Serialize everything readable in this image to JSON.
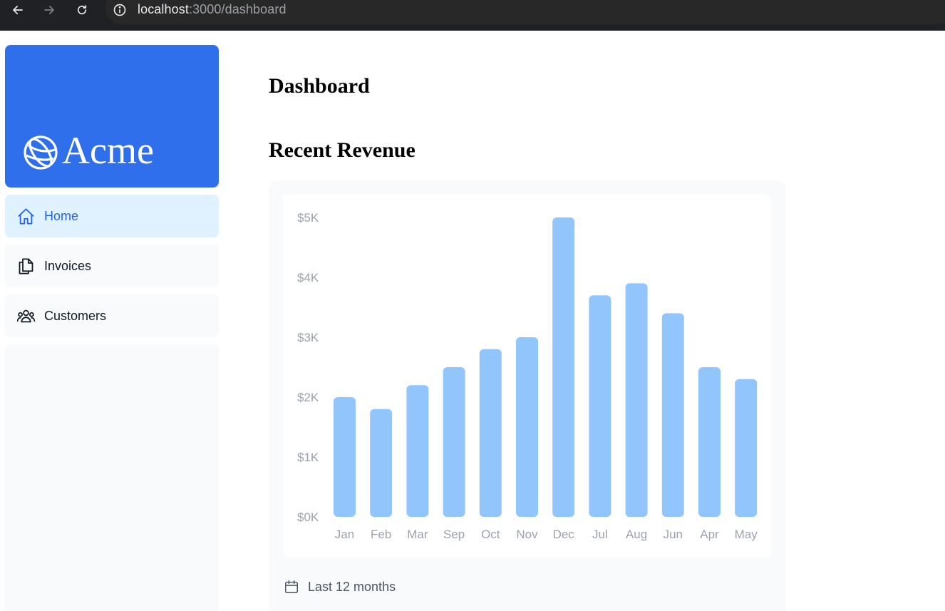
{
  "browser": {
    "url_host": "localhost",
    "url_path": ":3000/dashboard",
    "back_icon": "arrow-left-icon",
    "forward_icon": "arrow-right-icon",
    "reload_icon": "reload-icon",
    "info_icon": "info-icon"
  },
  "sidebar": {
    "logo_text": "Acme",
    "logo_icon": "globe-icon",
    "brand_color": "#2f6feb",
    "items": [
      {
        "label": "Home",
        "icon": "home-icon",
        "active": true
      },
      {
        "label": "Invoices",
        "icon": "document-duplicate-icon",
        "active": false
      },
      {
        "label": "Customers",
        "icon": "user-group-icon",
        "active": false
      }
    ]
  },
  "main": {
    "title": "Dashboard",
    "section_title": "Recent Revenue",
    "footer_label": "Last 12 months",
    "footer_icon": "calendar-icon"
  },
  "chart_data": {
    "type": "bar",
    "title": "",
    "xlabel": "",
    "ylabel": "",
    "categories": [
      "Jan",
      "Feb",
      "Mar",
      "Sep",
      "Oct",
      "Nov",
      "Dec",
      "Jul",
      "Aug",
      "Jun",
      "Apr",
      "May"
    ],
    "values": [
      2000,
      1800,
      2200,
      2500,
      2800,
      3000,
      5000,
      3700,
      3900,
      3400,
      2500,
      2300
    ],
    "ylim": [
      0,
      5000
    ],
    "yticks": [
      5000,
      4000,
      3000,
      2000,
      1000,
      0
    ],
    "ytick_labels": [
      "$5K",
      "$4K",
      "$3K",
      "$2K",
      "$1K",
      "$0K"
    ],
    "bar_color": "#93c5fd",
    "tick_color": "#9ca3af",
    "grid": false
  }
}
